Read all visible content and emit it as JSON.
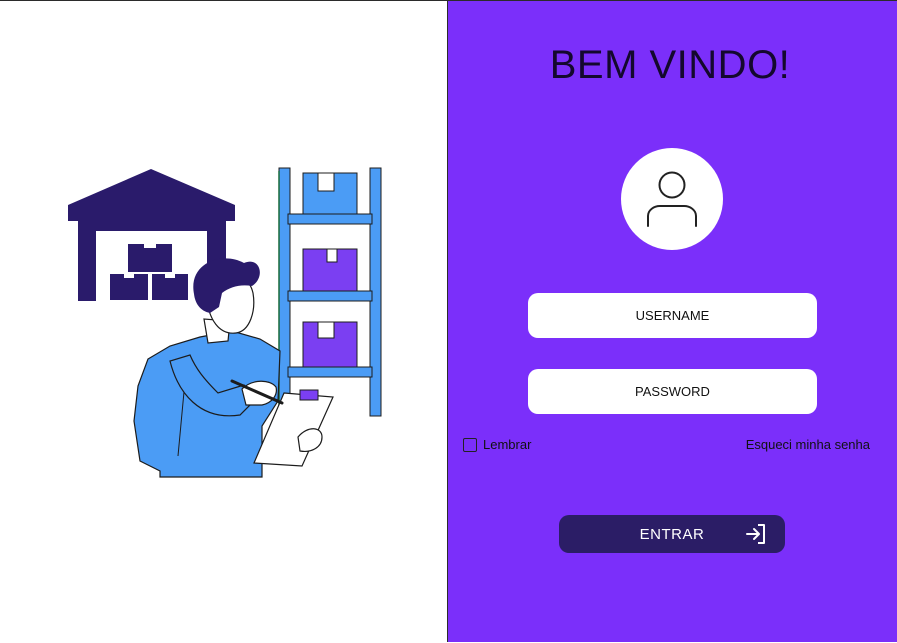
{
  "welcome_title": "BEM VINDO!",
  "form": {
    "username_placeholder": "USERNAME",
    "password_placeholder": "PASSWORD",
    "remember_label": "Lembrar",
    "forgot_link": "Esqueci minha senha",
    "submit_label": "ENTRAR"
  },
  "icons": {
    "avatar": "user-icon",
    "submit": "sign-in-icon"
  },
  "colors": {
    "accent": "#7b2ffa",
    "dark": "#2b1d66",
    "shelf_blue": "#4b9cf5",
    "box_purple": "#7b3ff2",
    "warehouse": "#2a1b6b"
  }
}
